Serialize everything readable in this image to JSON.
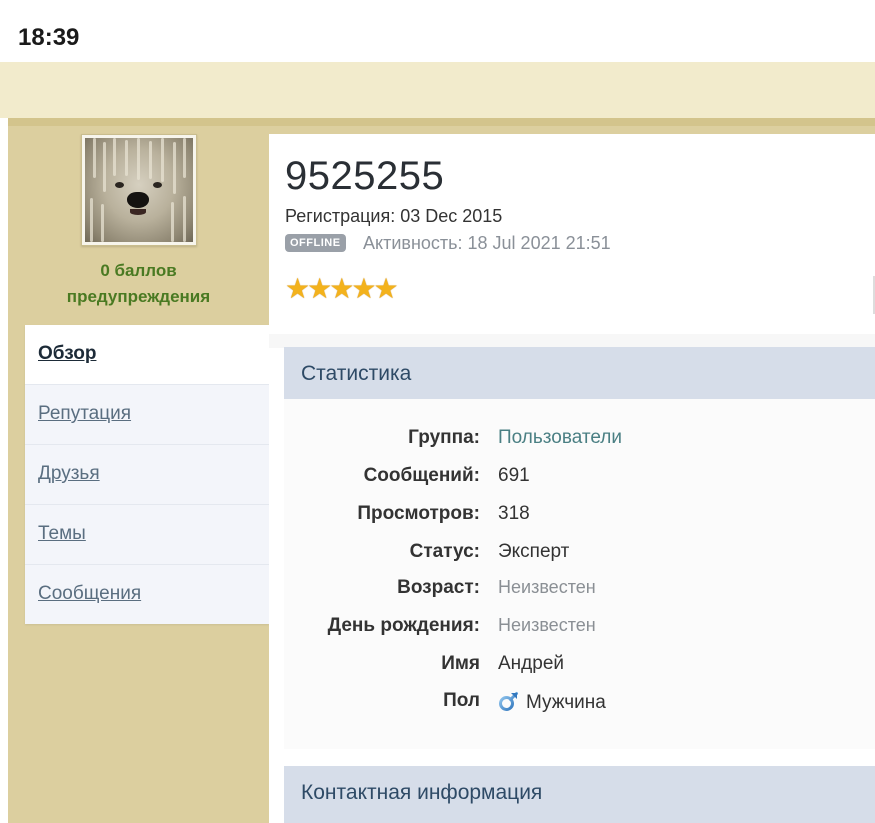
{
  "status_bar": {
    "time": "18:39"
  },
  "sidebar": {
    "warnings_label": "0 баллов предупреждения",
    "nav": [
      {
        "label": "Обзор",
        "active": true
      },
      {
        "label": "Репутация",
        "active": false
      },
      {
        "label": "Друзья",
        "active": false
      },
      {
        "label": "Темы",
        "active": false
      },
      {
        "label": "Сообщения",
        "active": false
      }
    ]
  },
  "profile": {
    "username": "9525255",
    "registration": "Регистрация: 03 Dec 2015",
    "status_badge": "OFFLINE",
    "activity": "Активность: 18 Jul 2021 21:51",
    "rating_stars": 5
  },
  "stats": {
    "title": "Статистика",
    "rows": [
      {
        "label": "Группа:",
        "value": "Пользователи",
        "style": "link"
      },
      {
        "label": "Сообщений:",
        "value": "691",
        "style": "normal"
      },
      {
        "label": "Просмотров:",
        "value": "318",
        "style": "normal"
      },
      {
        "label": "Статус:",
        "value": "Эксперт",
        "style": "normal"
      },
      {
        "label": "Возраст:",
        "value": "Неизвестен",
        "style": "muted"
      },
      {
        "label": "День рождения:",
        "value": "Неизвестен",
        "style": "muted"
      },
      {
        "label": "Имя",
        "value": "Андрей",
        "style": "normal"
      },
      {
        "label": "Пол",
        "value": "Мужчина",
        "style": "normal",
        "icon": "male-gender-icon"
      }
    ]
  },
  "contact": {
    "title": "Контактная информация"
  },
  "colors": {
    "top_banner": "#f2ebcc",
    "sidebar_bg": "#dccf9f",
    "warning_link": "#4a7a22",
    "section_header": "#d6dde9",
    "section_title": "#2e4a66",
    "group_link": "#4a7f83",
    "star": "#f3b21c"
  }
}
